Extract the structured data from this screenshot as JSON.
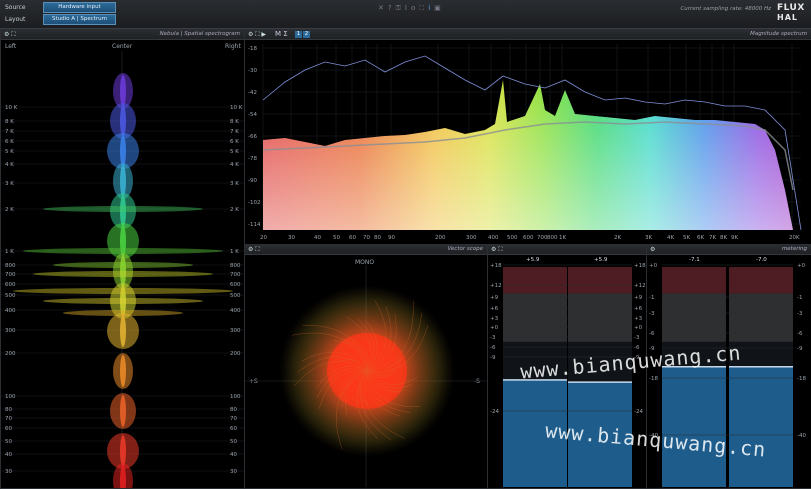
{
  "topbar": {
    "source_label": "Source",
    "layout_label": "Layout",
    "source_value": "Hardware input",
    "layout_value": "Studio A | Spectrum",
    "sampling_rate": "Current sampling rate: 48000 Hz",
    "logo_top": "FLUX",
    "logo_bottom": "HAL"
  },
  "nebula": {
    "title": "Nebula | Spatial spectrogram",
    "left": "Left",
    "center": "Center",
    "right": "Right",
    "freq_labels": [
      "10 K",
      "8 K",
      "7 K",
      "6 K",
      "5 K",
      "4 K",
      "3 K",
      "2 K",
      "1 K",
      "800",
      "700",
      "600",
      "500",
      "400",
      "300",
      "200",
      "100",
      "80",
      "70",
      "60",
      "50",
      "40",
      "30"
    ]
  },
  "spectrum": {
    "title": "Magnitude spectrum",
    "toolbar": "M Σ",
    "toggle_1": "1",
    "toggle_2": "2",
    "db_labels": [
      "-18",
      "-30",
      "-42",
      "-54",
      "-66",
      "-78",
      "-90",
      "-102",
      "-114"
    ],
    "freq_labels": [
      "20",
      "30",
      "40",
      "50",
      "60",
      "70",
      "80",
      "90",
      "200",
      "300",
      "400",
      "500",
      "600",
      "700",
      "800",
      "1K",
      "2K",
      "3K",
      "4K",
      "5K",
      "6K",
      "7K",
      "8K",
      "9K",
      "20K"
    ]
  },
  "vector": {
    "title": "Vector scope",
    "mono": "MONO",
    "plus_s": "+S",
    "minus_s": "-S"
  },
  "meter1": {
    "peak_left": "+5.9",
    "peak_right": "+5.9",
    "scale": [
      "+18",
      "+12",
      "+9",
      "+6",
      "+3",
      "+0",
      "-3",
      "-6",
      "-9",
      "-24"
    ],
    "levels": [
      0.49,
      0.48
    ]
  },
  "meter2": {
    "title": "metering",
    "peak_left": "-7.1",
    "peak_right": "-7.0",
    "scale": [
      "+0",
      "-1",
      "-3",
      "-6",
      "-9",
      "-18",
      "-40"
    ],
    "levels": [
      0.55,
      0.55
    ]
  },
  "watermark": "www.bianquwang.cn"
}
